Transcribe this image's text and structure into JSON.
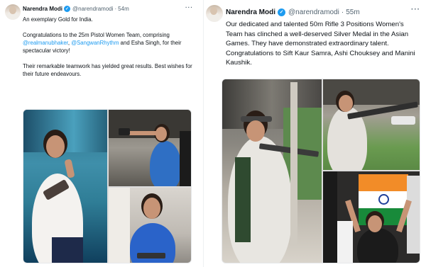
{
  "left_tweet": {
    "author_name": "Narendra Modi",
    "handle": "@narendramodi",
    "separator": "·",
    "time": "54m",
    "more": "···",
    "line1": "An exemplary Gold for India.",
    "para2_a": "Congratulations to the 25m Pistol Women Team, comprising ",
    "mention1": "@realmanubhaker",
    "para2_b": ", ",
    "mention2": "@SangwanRhythm",
    "para2_c": " and Esha Singh, for their spectacular victory!",
    "para3": "Their remarkable teamwork has yielded great results. Best wishes for their future endeavours."
  },
  "right_tweet": {
    "author_name": "Narendra Modi",
    "handle": "@narendramodi",
    "separator": "·",
    "time": "55m",
    "more": "···",
    "text": "Our dedicated and talented 50m Rifle 3 Positions Women's Team has clinched a well-deserved Silver Medal in the Asian Games. They have demonstrated extraordinary talent. Congratulations to Sift Kaur Samra, Ashi Chouksey and Manini Kaushik."
  },
  "icons": {
    "verified": "verified-badge-icon",
    "check": "✓"
  },
  "colors": {
    "link": "#1d9bf0",
    "verified": "#1d9bf0",
    "secondary_text": "#536471"
  }
}
